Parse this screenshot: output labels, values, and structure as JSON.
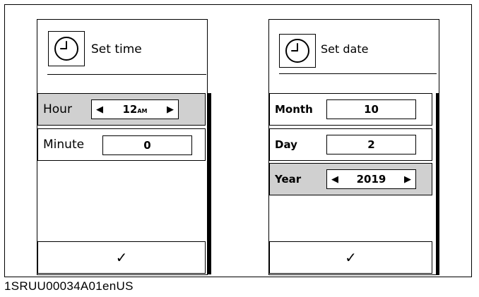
{
  "caption": "1SRUU00034A01enUS",
  "time_screen": {
    "title": "Set time",
    "hour": {
      "label": "Hour",
      "value": "12",
      "meridiem": "AM"
    },
    "minute": {
      "label": "Minute",
      "value": "0"
    },
    "confirm_glyph": "✓"
  },
  "date_screen": {
    "title": "Set date",
    "month": {
      "label": "Month",
      "value": "10"
    },
    "day": {
      "label": "Day",
      "value": "2"
    },
    "year": {
      "label": "Year",
      "value": "2019"
    },
    "confirm_glyph": "✓"
  },
  "icons": {
    "clock": "clock-icon",
    "decrease": "arrow-left-icon",
    "increase": "arrow-right-icon",
    "confirm": "checkmark-icon"
  },
  "glyphs": {
    "left": "◀",
    "right": "▶"
  }
}
